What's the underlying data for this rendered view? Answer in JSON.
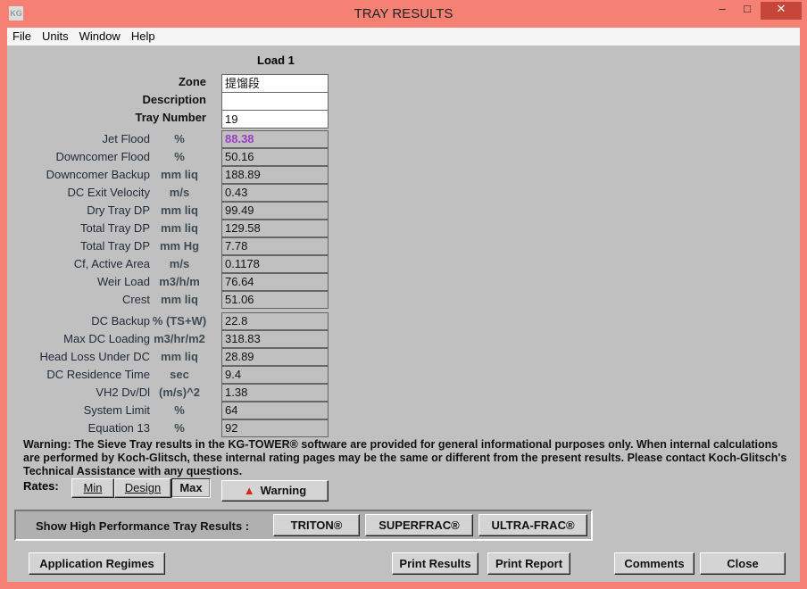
{
  "window": {
    "title": "TRAY RESULTS",
    "logo": "KG",
    "min": "–",
    "max": "□",
    "close": "✕"
  },
  "menu": [
    "File",
    "Units",
    "Window",
    "Help"
  ],
  "load": "Load 1",
  "header": {
    "zone_label": "Zone",
    "zone": "提馏段",
    "desc_label": "Description",
    "desc": "",
    "tray_label": "Tray Number",
    "tray": "19"
  },
  "group1": [
    {
      "name": "Jet Flood",
      "unit": "%",
      "value": "88.38"
    },
    {
      "name": "Downcomer Flood",
      "unit": "%",
      "value": "50.16"
    },
    {
      "name": "Downcomer Backup",
      "unit": "mm liq",
      "value": "188.89"
    },
    {
      "name": "DC Exit Velocity",
      "unit": "m/s",
      "value": "0.43"
    },
    {
      "name": "Dry Tray DP",
      "unit": "mm liq",
      "value": "99.49"
    },
    {
      "name": "Total Tray DP",
      "unit": "mm liq",
      "value": "129.58"
    },
    {
      "name": "Total Tray DP",
      "unit": "mm Hg",
      "value": "7.78"
    },
    {
      "name": "Cf, Active Area",
      "unit": "m/s",
      "value": "0.1178"
    },
    {
      "name": "Weir Load",
      "unit": "m3/h/m",
      "value": "76.64"
    },
    {
      "name": "Crest",
      "unit": "mm liq",
      "value": "51.06"
    }
  ],
  "group2": [
    {
      "name": "DC Backup",
      "unit": "% (TS+W)",
      "value": "22.8"
    },
    {
      "name": "Max DC Loading",
      "unit": "m3/hr/m2",
      "value": "318.83"
    },
    {
      "name": "Head Loss Under DC",
      "unit": "mm liq",
      "value": "28.89"
    },
    {
      "name": "DC Residence Time",
      "unit": "sec",
      "value": "9.4"
    },
    {
      "name": "VH2 Dv/Dl",
      "unit": "(m/s)^2",
      "value": "1.38"
    },
    {
      "name": "System Limit",
      "unit": "%",
      "value": "64"
    },
    {
      "name": "Equation 13",
      "unit": "%",
      "value": "92"
    }
  ],
  "highlight_color": "#9b3fc0",
  "warning_text": "Warning: The Sieve Tray results in the KG-TOWER® software are provided for general informational purposes only. When internal calculations are performed by Koch-Glitsch, these internal rating pages may be the same or different from the present results. Please contact Koch-Glitsch's Technical Assistance with any questions.",
  "rates": {
    "label": "Rates:",
    "min": "Min",
    "design": "Design",
    "max": "Max"
  },
  "warning_button": "Warning",
  "hp": {
    "label": "Show High Performance Tray Results :",
    "triton": "TRITON®",
    "superfrac": "SUPERFRAC®",
    "ultrafrac": "ULTRA-FRAC®"
  },
  "buttons": {
    "regimes": "Application Regimes",
    "print_results": "Print Results",
    "print_report": "Print Report",
    "comments": "Comments",
    "close": "Close"
  }
}
